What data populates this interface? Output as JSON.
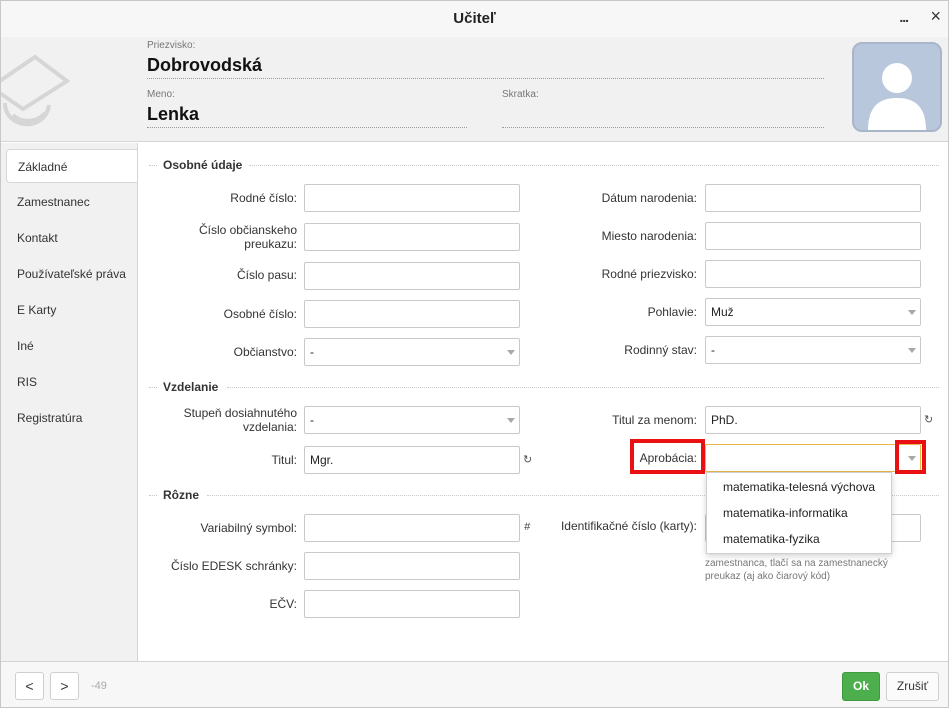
{
  "window": {
    "title": "Učiteľ",
    "more_label": "...",
    "close_label": "×"
  },
  "header": {
    "surname_label": "Priezvisko:",
    "surname_value": "Dobrovodská",
    "name_label": "Meno:",
    "name_value": "Lenka",
    "abbr_label": "Skratka:",
    "abbr_value": ""
  },
  "sidebar": {
    "items": [
      {
        "label": "Základné",
        "active": true
      },
      {
        "label": "Zamestnanec"
      },
      {
        "label": "Kontakt"
      },
      {
        "label": "Používateľské práva"
      },
      {
        "label": "E Karty"
      },
      {
        "label": "Iné"
      },
      {
        "label": "RIS"
      },
      {
        "label": "Registratúra"
      }
    ]
  },
  "sections": {
    "personal": "Osobné údaje",
    "education": "Vzdelanie",
    "misc": "Rôzne"
  },
  "personal": {
    "rodne_cislo": {
      "label": "Rodné číslo:",
      "value": ""
    },
    "cislo_op": {
      "label": "Číslo občianskeho preukazu:",
      "value": ""
    },
    "cislo_pasu": {
      "label": "Číslo pasu:",
      "value": ""
    },
    "osobne_cislo": {
      "label": "Osobné číslo:",
      "value": ""
    },
    "obcianstvo": {
      "label": "Občianstvo:",
      "value": "-"
    },
    "datum_narodenia": {
      "label": "Dátum narodenia:",
      "value": ""
    },
    "miesto_narodenia": {
      "label": "Miesto narodenia:",
      "value": ""
    },
    "rodne_priezvisko": {
      "label": "Rodné priezvisko:",
      "value": ""
    },
    "pohlavie": {
      "label": "Pohlavie:",
      "value": "Muž"
    },
    "rodinny_stav": {
      "label": "Rodinný stav:",
      "value": "-"
    }
  },
  "education": {
    "stupen": {
      "label": "Stupeň dosiahnutého vzdelania:",
      "value": "-"
    },
    "titul": {
      "label": "Titul:",
      "value": "Mgr."
    },
    "titul_za": {
      "label": "Titul za menom:",
      "value": "PhD."
    },
    "aprobacia": {
      "label": "Aprobácia:",
      "value": ""
    },
    "aprobacia_options": [
      "matematika-telesná výchova",
      "matematika-informatika",
      "matematika-fyzika"
    ]
  },
  "misc": {
    "variabilny": {
      "label": "Variabilný symbol:",
      "value": ""
    },
    "edesk": {
      "label": "Číslo EDESK schránky:",
      "value": ""
    },
    "ecv": {
      "label": "EČV:",
      "value": ""
    },
    "id_karty": {
      "label": "Identifikačné číslo (karty):",
      "value": ""
    },
    "note": "zamestnanca, tlačí sa na zamestnanecký preukaz (aj ako čiarový kód)"
  },
  "icons": {
    "refresh": "↻",
    "hash": "#"
  },
  "footer": {
    "prev_label": "<",
    "next_label": ">",
    "counter": "-49",
    "ok_label": "Ok",
    "cancel_label": "Zrušiť"
  },
  "colors": {
    "ok_green": "#4cae4c",
    "highlight_red": "#e81010",
    "avatar_bg": "#b9c7dc"
  }
}
